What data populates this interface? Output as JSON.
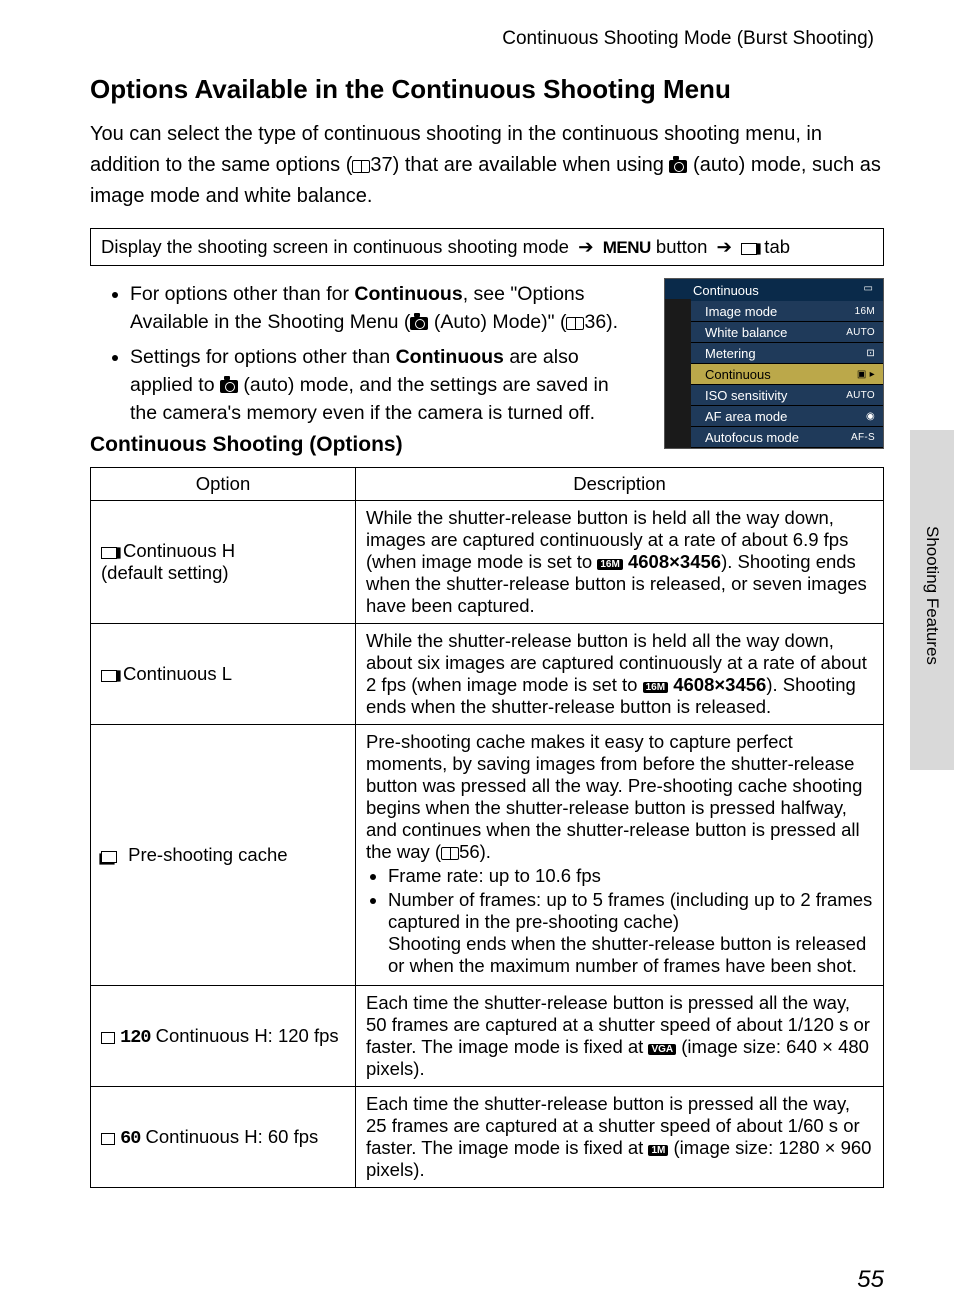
{
  "running_head": "Continuous Shooting Mode (Burst Shooting)",
  "section_title": "Options Available in the Continuous Shooting Menu",
  "intro_p1_a": "You can select the type of continuous shooting in the continuous shooting menu, in addition to the same options (",
  "intro_p1_ref": "37",
  "intro_p1_b": ") that are available when using ",
  "intro_p1_c": " (auto) mode, such as image mode and white balance.",
  "nav": {
    "a": "Display the shooting screen in continuous shooting mode ",
    "menu_word": "MENU",
    "b": " button ",
    "c": " tab"
  },
  "bullets": {
    "b1a": "For options other than for ",
    "b1bold": "Continuous",
    "b1b": ", see \"Options Available in the Shooting Menu (",
    "b1c": " (Auto) Mode)\" (",
    "b1ref": "36",
    "b1d": ").",
    "b2a": "Settings for options other than ",
    "b2bold": "Continuous",
    "b2b": " are also applied to ",
    "b2c": " (auto) mode, and the settings are saved in the camera's memory even if the camera is turned off."
  },
  "menu_shot": {
    "title": "Continuous",
    "items": [
      {
        "label": "Image mode",
        "badge": "16M",
        "sel": false
      },
      {
        "label": "White balance",
        "badge": "AUTO",
        "sel": false
      },
      {
        "label": "Metering",
        "badge": "⊡",
        "sel": false
      },
      {
        "label": "Continuous",
        "badge": "▣ ▸",
        "sel": true
      },
      {
        "label": "ISO sensitivity",
        "badge": "AUTO",
        "sel": false
      },
      {
        "label": "AF area mode",
        "badge": "◉",
        "sel": false
      },
      {
        "label": "Autofocus mode",
        "badge": "AF-S",
        "sel": false
      }
    ]
  },
  "sub_title": "Continuous Shooting (Options)",
  "table": {
    "h1": "Option",
    "h2": "Description",
    "rows": [
      {
        "opt_label": "Continuous H",
        "opt_sub": "(default setting)",
        "icon": "burst",
        "desc_a": "While the shutter-release button is held all the way down, images are captured continuously at a rate of about 6.9 fps (when image mode is set to ",
        "desc_res_icon": "16M",
        "desc_b": " 4608×3456",
        "desc_c": "). Shooting ends when the shutter-release button is released, or seven images have been captured."
      },
      {
        "opt_label": "Continuous L",
        "opt_sub": "",
        "icon": "burst",
        "desc_a": "While the shutter-release button is held all the way down, about six images are captured continuously at a rate of about 2 fps (when image mode is set to ",
        "desc_res_icon": "16M",
        "desc_b": " 4608×3456",
        "desc_c": "). Shooting ends when the shutter-release button is released."
      },
      {
        "opt_label": "Pre-shooting cache",
        "opt_sub": "",
        "icon": "cache",
        "desc_a": "Pre-shooting cache makes it easy to capture perfect moments, by saving images from before the shutter-release button was pressed all the way. Pre-shooting cache shooting begins when the shutter-release button is pressed halfway, and continues when the shutter-release button is pressed all the way (",
        "desc_ref": "56",
        "desc_b": ").",
        "li1": "Frame rate: up to 10.6 fps",
        "li2": "Number of frames: up to 5 frames (including up to 2 frames captured in the pre-shooting cache)",
        "desc_c": "Shooting ends when the shutter-release button is released or when the maximum number of frames have been shot."
      },
      {
        "opt_num": "120",
        "opt_label": "Continuous H: 120 fps",
        "icon": "frame",
        "desc_a": "Each time the shutter-release button is pressed all the way, 50 frames are captured at a shutter speed of about 1/120 s or faster. The image mode is fixed at ",
        "desc_res_icon": "VGA",
        "desc_c": " (image size: 640 × 480 pixels)."
      },
      {
        "opt_num": "60",
        "opt_label": "Continuous H: 60 fps",
        "icon": "frame",
        "desc_a": "Each time the shutter-release button is pressed all the way, 25 frames are captured at a shutter speed of about 1/60 s or faster. The image mode is fixed at ",
        "desc_res_icon": "1M",
        "desc_c": " (image size: 1280 × 960 pixels)."
      }
    ]
  },
  "side_tab": "Shooting Features",
  "page_number": "55"
}
